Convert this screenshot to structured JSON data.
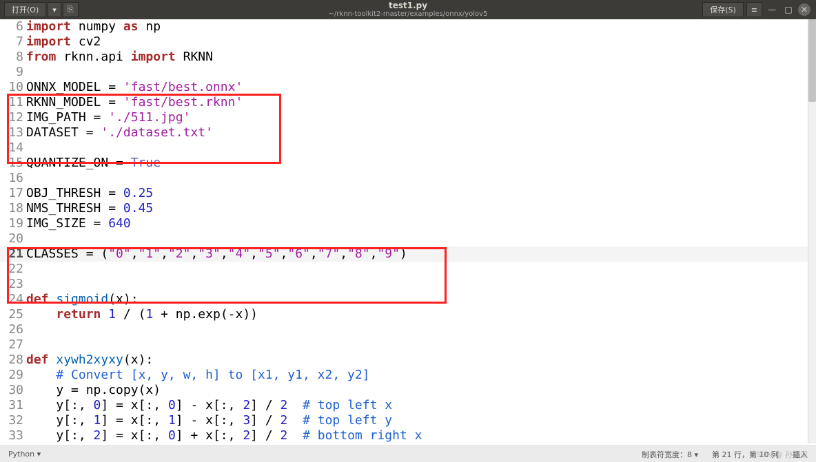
{
  "titlebar": {
    "open_label": "打开(O)",
    "title": "test1.py",
    "subtitle": "~/rknn-toolkit2-master/examples/onnx/yolov5",
    "save_label": "保存(S)"
  },
  "code": {
    "lines": [
      {
        "n": 6,
        "tokens": [
          {
            "t": "import",
            "c": "kw"
          },
          {
            "t": " numpy "
          },
          {
            "t": "as",
            "c": "kw"
          },
          {
            "t": " np"
          }
        ]
      },
      {
        "n": 7,
        "tokens": [
          {
            "t": "import",
            "c": "kw"
          },
          {
            "t": " cv2"
          }
        ]
      },
      {
        "n": 8,
        "tokens": [
          {
            "t": "from",
            "c": "kw"
          },
          {
            "t": " rknn.api "
          },
          {
            "t": "import",
            "c": "kw"
          },
          {
            "t": " RKNN"
          }
        ]
      },
      {
        "n": 9,
        "tokens": []
      },
      {
        "n": 10,
        "tokens": [
          {
            "t": "ONNX_MODEL = "
          },
          {
            "t": "'fast/best.onnx'",
            "c": "str"
          }
        ]
      },
      {
        "n": 11,
        "tokens": [
          {
            "t": "RKNN_MODEL = "
          },
          {
            "t": "'fast/best.rknn'",
            "c": "str"
          }
        ]
      },
      {
        "n": 12,
        "tokens": [
          {
            "t": "IMG_PATH = "
          },
          {
            "t": "'./511.jpg'",
            "c": "str"
          }
        ]
      },
      {
        "n": 13,
        "tokens": [
          {
            "t": "DATASET = "
          },
          {
            "t": "'./dataset.txt'",
            "c": "str"
          }
        ]
      },
      {
        "n": 14,
        "tokens": []
      },
      {
        "n": 15,
        "tokens": [
          {
            "t": "QUANTIZE_ON = "
          },
          {
            "t": "True",
            "c": "bool"
          }
        ]
      },
      {
        "n": 16,
        "tokens": []
      },
      {
        "n": 17,
        "tokens": [
          {
            "t": "OBJ_THRESH = "
          },
          {
            "t": "0.25",
            "c": "num"
          }
        ]
      },
      {
        "n": 18,
        "tokens": [
          {
            "t": "NMS_THRESH = "
          },
          {
            "t": "0.45",
            "c": "num"
          }
        ]
      },
      {
        "n": 19,
        "tokens": [
          {
            "t": "IMG_SIZE = "
          },
          {
            "t": "640",
            "c": "num"
          }
        ]
      },
      {
        "n": 20,
        "tokens": []
      },
      {
        "n": 21,
        "current": true,
        "tokens": [
          {
            "t": "CLASSES = ("
          },
          {
            "t": "\"0\"",
            "c": "str"
          },
          {
            "t": ","
          },
          {
            "t": "\"1\"",
            "c": "str"
          },
          {
            "t": ","
          },
          {
            "t": "\"2\"",
            "c": "str"
          },
          {
            "t": ","
          },
          {
            "t": "\"3\"",
            "c": "str"
          },
          {
            "t": ","
          },
          {
            "t": "\"4\"",
            "c": "str"
          },
          {
            "t": ","
          },
          {
            "t": "\"5\"",
            "c": "str"
          },
          {
            "t": ","
          },
          {
            "t": "\"6\"",
            "c": "str"
          },
          {
            "t": ","
          },
          {
            "t": "\"7\"",
            "c": "str"
          },
          {
            "t": ","
          },
          {
            "t": "\"8\"",
            "c": "str"
          },
          {
            "t": ","
          },
          {
            "t": "\"9\"",
            "c": "str"
          },
          {
            "t": ")"
          }
        ]
      },
      {
        "n": 22,
        "tokens": []
      },
      {
        "n": 23,
        "tokens": []
      },
      {
        "n": 24,
        "tokens": [
          {
            "t": "def ",
            "c": "kw"
          },
          {
            "t": "sigmoid",
            "c": "fn"
          },
          {
            "t": "(x):"
          }
        ]
      },
      {
        "n": 25,
        "tokens": [
          {
            "t": "    "
          },
          {
            "t": "return",
            "c": "kw"
          },
          {
            "t": " "
          },
          {
            "t": "1",
            "c": "num"
          },
          {
            "t": " / ("
          },
          {
            "t": "1",
            "c": "num"
          },
          {
            "t": " + np.exp(-x))"
          }
        ]
      },
      {
        "n": 26,
        "tokens": []
      },
      {
        "n": 27,
        "tokens": []
      },
      {
        "n": 28,
        "tokens": [
          {
            "t": "def ",
            "c": "kw"
          },
          {
            "t": "xywh2xyxy",
            "c": "fn"
          },
          {
            "t": "(x):"
          }
        ]
      },
      {
        "n": 29,
        "tokens": [
          {
            "t": "    "
          },
          {
            "t": "# Convert [x, y, w, h] to [x1, y1, x2, y2]",
            "c": "cm"
          }
        ]
      },
      {
        "n": 30,
        "tokens": [
          {
            "t": "    y = np.copy(x)"
          }
        ]
      },
      {
        "n": 31,
        "tokens": [
          {
            "t": "    y[:, "
          },
          {
            "t": "0",
            "c": "num"
          },
          {
            "t": "] = x[:, "
          },
          {
            "t": "0",
            "c": "num"
          },
          {
            "t": "] - x[:, "
          },
          {
            "t": "2",
            "c": "num"
          },
          {
            "t": "] / "
          },
          {
            "t": "2",
            "c": "num"
          },
          {
            "t": "  "
          },
          {
            "t": "# top left x",
            "c": "cm"
          }
        ]
      },
      {
        "n": 32,
        "tokens": [
          {
            "t": "    y[:, "
          },
          {
            "t": "1",
            "c": "num"
          },
          {
            "t": "] = x[:, "
          },
          {
            "t": "1",
            "c": "num"
          },
          {
            "t": "] - x[:, "
          },
          {
            "t": "3",
            "c": "num"
          },
          {
            "t": "] / "
          },
          {
            "t": "2",
            "c": "num"
          },
          {
            "t": "  "
          },
          {
            "t": "# top left y",
            "c": "cm"
          }
        ]
      },
      {
        "n": 33,
        "tokens": [
          {
            "t": "    y[:, "
          },
          {
            "t": "2",
            "c": "num"
          },
          {
            "t": "] = x[:, "
          },
          {
            "t": "0",
            "c": "num"
          },
          {
            "t": "] + x[:, "
          },
          {
            "t": "2",
            "c": "num"
          },
          {
            "t": "] / "
          },
          {
            "t": "2",
            "c": "num"
          },
          {
            "t": "  "
          },
          {
            "t": "# bottom right x",
            "c": "cm"
          }
        ]
      }
    ]
  },
  "statusbar": {
    "language": "Python ▾",
    "tab_width": "制表符宽度：8 ▾",
    "position": "第 21 行，第 10 列",
    "insert_mode": "插入"
  },
  "watermark": "CSDN @ 孙麾深"
}
